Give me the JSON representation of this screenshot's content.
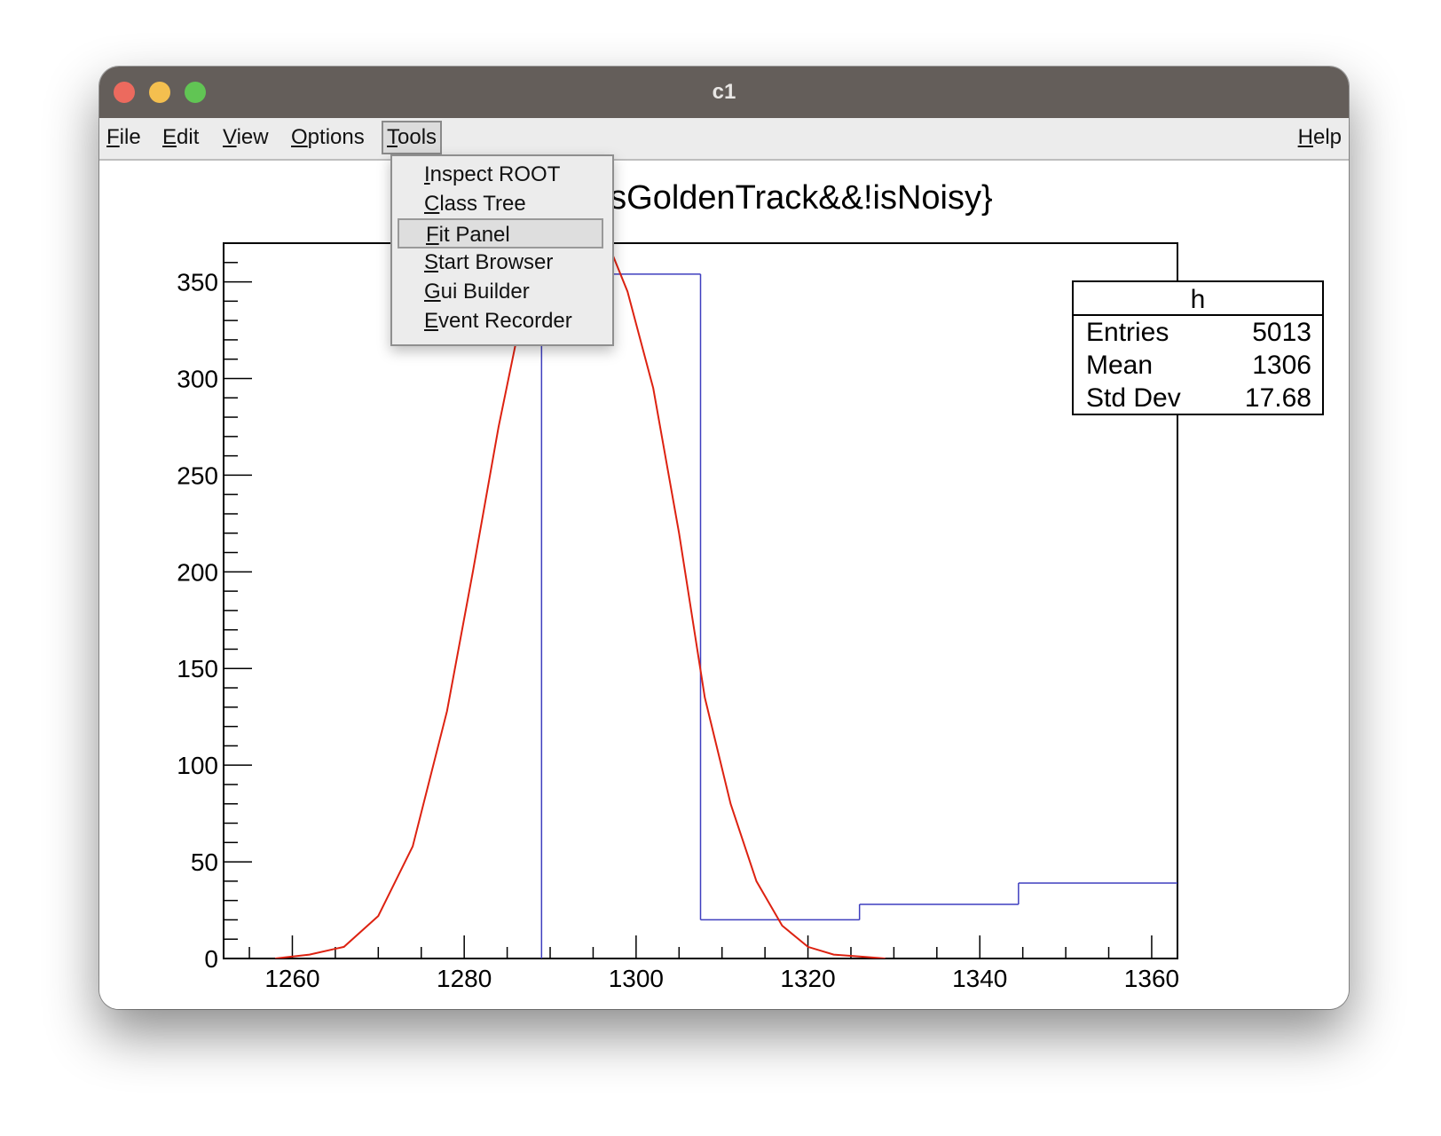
{
  "window": {
    "title": "c1",
    "colors": {
      "titlebar": "#645e5a",
      "close": "#ec6a5e",
      "minimize": "#f4bf4f",
      "maximize": "#61c554"
    }
  },
  "menubar": {
    "file": {
      "mnemonic": "F",
      "rest": "ile"
    },
    "edit": {
      "mnemonic": "E",
      "rest": "dit"
    },
    "view": {
      "mnemonic": "V",
      "rest": "iew"
    },
    "options": {
      "mnemonic": "O",
      "rest": "ptions"
    },
    "tools": {
      "mnemonic": "T",
      "rest": "ools"
    },
    "help": {
      "mnemonic": "H",
      "rest": "elp"
    }
  },
  "tools_menu": {
    "items": [
      {
        "mnemonic": "I",
        "rest": "nspect ROOT"
      },
      {
        "mnemonic": "C",
        "rest": "lass Tree"
      },
      {
        "mnemonic": "F",
        "rest": "it Panel"
      },
      {
        "mnemonic": "S",
        "rest": "tart Browser"
      },
      {
        "mnemonic": "G",
        "rest": "ui Builder"
      },
      {
        "mnemonic": "E",
        "rest": "vent Recorder"
      }
    ],
    "highlighted": "Fit Panel"
  },
  "stats_box": {
    "title": "h",
    "entries_label": "Entries",
    "entries_value": "5013",
    "mean_label": "Mean",
    "mean_value": "1306",
    "stddev_label": "Std Dev",
    "stddev_value": "17.68"
  },
  "chart_data": {
    "type": "bar",
    "title": "{isGoldenTrack&&!isNoisy}",
    "xlim": [
      1252,
      1363
    ],
    "ylim": [
      0,
      370
    ],
    "x_ticks": [
      1260,
      1280,
      1300,
      1320,
      1340,
      1360
    ],
    "x_tick_labels": [
      "1260",
      "1280",
      "1300",
      "1320",
      "1340",
      "1360"
    ],
    "y_ticks": [
      0,
      50,
      100,
      150,
      200,
      250,
      300,
      350
    ],
    "y_tick_labels": [
      "0",
      "50",
      "100",
      "150",
      "200",
      "250",
      "300",
      "350"
    ],
    "grid": false,
    "legend": "top-right",
    "histogram": {
      "color": "#3f3fbf",
      "bin_edges": [
        1289,
        1307.5,
        1326,
        1344.5,
        1363
      ],
      "values": [
        354,
        20,
        28,
        39
      ]
    },
    "fit": {
      "type": "gaussian",
      "color": "#dd2211",
      "x": [
        1258,
        1262,
        1266,
        1270,
        1274,
        1278,
        1281,
        1284,
        1287,
        1290,
        1293,
        1296,
        1299,
        1302,
        1305,
        1308,
        1311,
        1314,
        1317,
        1320,
        1323,
        1326,
        1329
      ],
      "y": [
        0,
        2,
        6,
        22,
        58,
        128,
        200,
        275,
        340,
        380,
        390,
        378,
        345,
        295,
        220,
        135,
        80,
        40,
        17,
        6,
        2,
        1,
        0
      ]
    }
  }
}
